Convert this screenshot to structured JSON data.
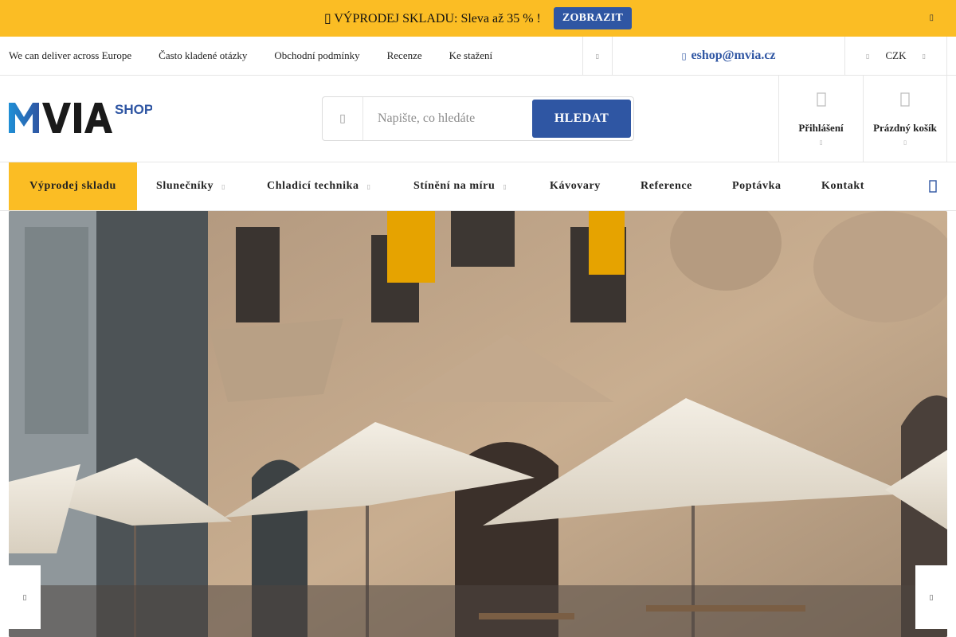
{
  "promo": {
    "text": "▯ VÝPRODEJ SKLADU: Sleva až 35 % !",
    "button": "ZOBRAZIT",
    "close_icon": "close-icon",
    "colors": {
      "background": "#fbbd24",
      "button": "#2f56a3"
    }
  },
  "toplinks": {
    "items": [
      "We can deliver across Europe",
      "Často kladené otázky",
      "Obchodní podmínky",
      "Recenze",
      "Ke stažení"
    ],
    "more_icon": "chevron-down-icon",
    "email": "eshop@mvia.cz",
    "email_icon": "mail-icon",
    "currency": "CZK"
  },
  "header": {
    "logo": {
      "main": "MVIA",
      "sub": "SHOP"
    },
    "search": {
      "placeholder": "Napište, co hledáte",
      "value": "",
      "button": "HLEDAT"
    },
    "login_label": "Přihlášení",
    "cart_label": "Prázdný košík"
  },
  "nav": {
    "items": [
      {
        "label": "Výprodej skladu",
        "dropdown": false,
        "highlight": true
      },
      {
        "label": "Slunečníky",
        "dropdown": true
      },
      {
        "label": "Chladicí technika",
        "dropdown": true
      },
      {
        "label": "Stínění na míru",
        "dropdown": true
      },
      {
        "label": "Kávovary",
        "dropdown": false
      },
      {
        "label": "Reference",
        "dropdown": false
      },
      {
        "label": "Poptávka",
        "dropdown": false
      },
      {
        "label": "Kontakt",
        "dropdown": false
      }
    ],
    "search_icon": "search-icon"
  },
  "hero": {
    "image": "building-facade-with-white-parasols",
    "prev_icon": "arrow-left-icon",
    "next_icon": "arrow-right-icon"
  },
  "colors": {
    "accent": "#2f56a3",
    "highlight": "#fbbd24",
    "border": "#e6e6e6"
  }
}
